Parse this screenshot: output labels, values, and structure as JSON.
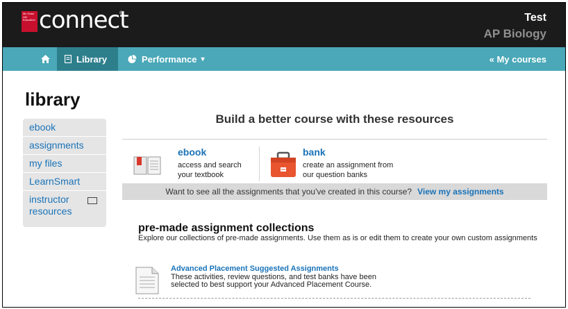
{
  "header": {
    "logo_text": "connect",
    "logo_mark": "Mc Graw Hill Education",
    "registered": "®",
    "user_name": "Test",
    "course_name": "AP Biology"
  },
  "nav": {
    "home_icon": "home-icon",
    "library_label": "Library",
    "performance_label": "Performance",
    "performance_caret": "▾",
    "my_courses_label": "« My courses",
    "colors": {
      "bar": "#4aa8b8",
      "active": "#2e7f8c",
      "link": "#1a73b8"
    }
  },
  "page": {
    "title": "library"
  },
  "sidebar": {
    "items": [
      {
        "label": "ebook"
      },
      {
        "label": "assignments"
      },
      {
        "label": "my files"
      },
      {
        "label": "LearnSmart"
      },
      {
        "label": "instructor resources",
        "icon": "presentation-icon"
      }
    ]
  },
  "main": {
    "headline": "Build a better course with these resources",
    "resources": [
      {
        "title": "ebook",
        "desc": "access and search your textbook",
        "icon": "open-book-icon"
      },
      {
        "title": "bank",
        "desc": "create an assignment from our question banks",
        "icon": "toolbox-icon"
      }
    ],
    "band_text": "Want to see all the assignments that you've created in this course?",
    "band_link": "View my assignments",
    "collections": {
      "title": "pre-made assignment collections",
      "desc": "Explore our collections of pre-made assignments. Use them as is or edit them to create your own custom assignments",
      "items": [
        {
          "title": "Advanced Placement Suggested Assignments",
          "desc": "These activities, review questions, and test banks have been selected to best support your Advanced Placement Course.",
          "icon": "document-icon"
        }
      ]
    }
  }
}
